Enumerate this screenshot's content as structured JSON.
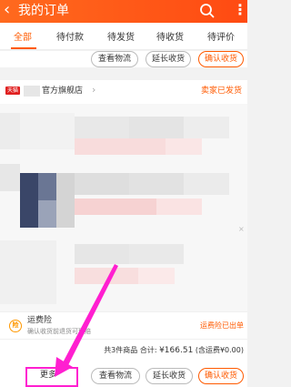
{
  "header": {
    "back_icon": "chevron-left-icon",
    "title": "我的订单",
    "search_icon": "search-icon",
    "more_icon": "more-vertical-icon"
  },
  "tabs": [
    "全部",
    "待付款",
    "待发货",
    "待收货",
    "待评价"
  ],
  "prev_order_actions": {
    "logistics": "查看物流",
    "extend": "延长收货",
    "confirm": "确认收货"
  },
  "order": {
    "store_logo": "天猫",
    "store_name": "官方旗舰店",
    "status": "卖家已发货",
    "insurance": {
      "title": "运费险",
      "subtitle": "确认收货前退货可理赔",
      "status": "运费险已出单"
    },
    "summary": {
      "count_text": "共3件商品",
      "total_label": "合计:",
      "total": "¥166.51",
      "shipping": "(含运费¥0.00)"
    },
    "actions": {
      "more": "更多",
      "logistics": "查看物流",
      "extend": "延长收货",
      "confirm": "确认收货"
    }
  },
  "colors": {
    "brand": "#ff5a00",
    "highlight": "#ff1fd0"
  }
}
